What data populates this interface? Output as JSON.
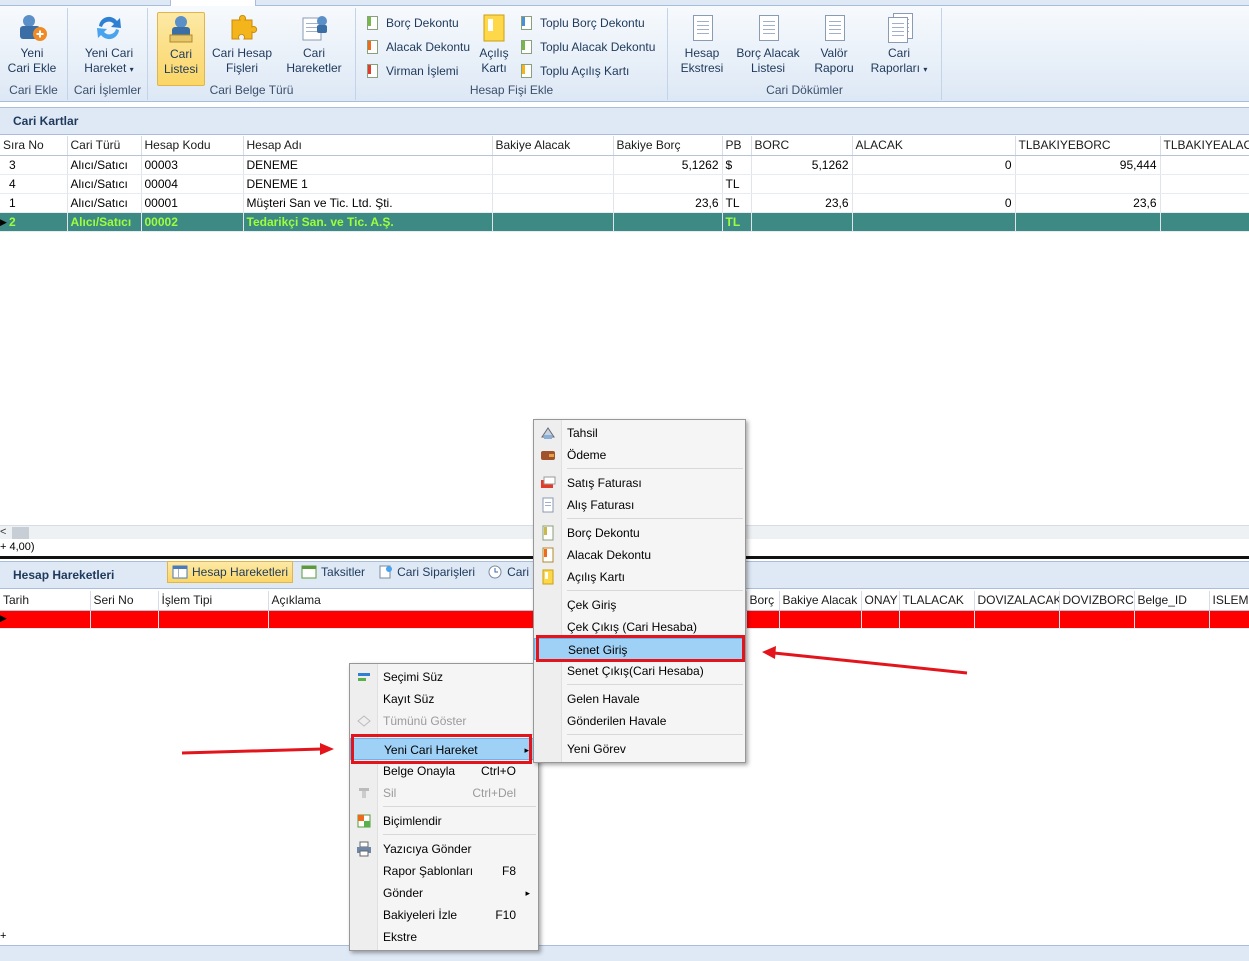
{
  "ribbon": {
    "groups": [
      {
        "caption": "Cari Ekle",
        "buttons": [
          {
            "label_l1": "Yeni",
            "label_l2": "Cari Ekle",
            "icon": "add-customer-icon"
          }
        ]
      },
      {
        "caption": "Cari İşlemler",
        "buttons": [
          {
            "label_l1": "Yeni Cari",
            "label_l2": "Hareket",
            "icon": "refresh-arrows-icon",
            "dropdown": "▾"
          }
        ]
      },
      {
        "caption": "Cari Belge Türü",
        "buttons": [
          {
            "label_l1": "Cari",
            "label_l2": "Listesi",
            "icon": "customer-list-icon"
          },
          {
            "label_l1": "Cari Hesap",
            "label_l2": "Fişleri",
            "icon": "puzzle-icon"
          },
          {
            "label_l1": "Cari",
            "label_l2": "Hareketler",
            "icon": "customer-movements-icon"
          }
        ]
      },
      {
        "caption": "Hesap Fişi Ekle",
        "small": [
          "Borç Dekontu",
          "Alacak Dekontu",
          "Virman İşlemi"
        ],
        "big": {
          "label_l1": "Açılış",
          "label_l2": "Kartı"
        },
        "small2": [
          "Toplu Borç Dekontu",
          "Toplu Alacak Dekontu",
          "Toplu Açılış Kartı"
        ]
      },
      {
        "caption": "Cari Dökümler",
        "buttons": [
          {
            "label_l1": "Hesap",
            "label_l2": "Ekstresi"
          },
          {
            "label_l1": "Borç Alacak",
            "label_l2": "Listesi"
          },
          {
            "label_l1": "Valör",
            "label_l2": "Raporu"
          },
          {
            "label_l1": "Cari",
            "label_l2": "Raporları",
            "dropdown": "▾"
          }
        ]
      }
    ]
  },
  "cari_kartlar": {
    "title": "Cari Kartlar",
    "columns": [
      "Sıra No",
      "Cari Türü",
      "Hesap Kodu",
      "Hesap Adı",
      "Bakiye Alacak",
      "Bakiye Borç",
      "PB",
      "BORC",
      "ALACAK",
      "TLBAKIYEBORC",
      "TLBAKIYEALACAK"
    ],
    "rows": [
      [
        "3",
        "Alıcı/Satıcı",
        "00003",
        "DENEME",
        "",
        "5,1262",
        "$",
        "5,1262",
        "0",
        "95,444",
        ""
      ],
      [
        "4",
        "Alıcı/Satıcı",
        "00004",
        "DENEME 1",
        "",
        "",
        "TL",
        "",
        "",
        "",
        ""
      ],
      [
        "1",
        "Alıcı/Satıcı",
        "00001",
        "Müşteri San ve Tic. Ltd. Şti.",
        "",
        "23,6",
        "TL",
        "23,6",
        "0",
        "23,6",
        ""
      ],
      [
        "2",
        "Alıcı/Satıcı",
        "00002",
        "Tedarikçi San. ve Tic. A.Ş.",
        "",
        "",
        "TL",
        "",
        "",
        "",
        ""
      ]
    ],
    "footer": "+ 4,00)",
    "scroll_left": "<"
  },
  "hesap_hareketleri": {
    "title": "Hesap Hareketleri",
    "tabs": [
      "Hesap Hareketleri",
      "Taksitler",
      "Cari Siparişleri",
      "Cari Görev"
    ],
    "columns": [
      "Tarih",
      "Seri No",
      "İşlem Tipi",
      "Açıklama",
      "Borç",
      "Bakiye Alacak",
      "ONAY",
      "TLALACAK",
      "DOVIZALACAK",
      "DOVIZBORC",
      "Belge_ID",
      "ISLEMKODU"
    ],
    "footer": "+"
  },
  "context_menu": {
    "items": [
      {
        "label": "Seçimi Süz",
        "icon": "filter-selection-icon"
      },
      {
        "label": "Kayıt Süz",
        "icon": ""
      },
      {
        "label": "Tümünü Göster",
        "icon": "show-all-icon",
        "disabled": true
      },
      {
        "sep": true
      },
      {
        "label": "Yeni Cari Hareket",
        "submenu": "▸",
        "highlighted": true
      },
      {
        "label": "Belge Onayla",
        "shortcut": "Ctrl+O"
      },
      {
        "label": "Sil",
        "shortcut": "Ctrl+Del",
        "icon": "delete-icon",
        "disabled": true
      },
      {
        "sep": true
      },
      {
        "label": "Biçimlendir",
        "icon": "format-icon"
      },
      {
        "sep": true
      },
      {
        "label": "Yazıcıya Gönder",
        "icon": "printer-icon"
      },
      {
        "label": "Rapor Şablonları",
        "shortcut": "F8"
      },
      {
        "label": "Gönder",
        "submenu": "▸"
      },
      {
        "label": "Bakiyeleri İzle",
        "shortcut": "F10"
      },
      {
        "label": "Ekstre"
      }
    ]
  },
  "submenu": {
    "items": [
      {
        "label": "Tahsil",
        "icon": "collect-icon"
      },
      {
        "label": "Ödeme",
        "icon": "payment-icon"
      },
      {
        "sep": true
      },
      {
        "label": "Satış Faturası",
        "icon": "sales-invoice-icon"
      },
      {
        "label": "Alış Faturası",
        "icon": "purchase-invoice-icon"
      },
      {
        "sep": true
      },
      {
        "label": "Borç Dekontu",
        "icon": "debit-note-icon"
      },
      {
        "label": "Alacak Dekontu",
        "icon": "credit-note-icon"
      },
      {
        "label": "Açılış Kartı",
        "icon": "opening-card-icon"
      },
      {
        "sep": true
      },
      {
        "label": "Çek Giriş"
      },
      {
        "label": "Çek Çıkış (Cari Hesaba)"
      },
      {
        "label": "Senet Giriş",
        "highlighted": true
      },
      {
        "label": "Senet Çıkış(Cari Hesaba)"
      },
      {
        "sep": true
      },
      {
        "label": "Gelen Havale"
      },
      {
        "label": "Gönderilen Havale"
      },
      {
        "sep": true
      },
      {
        "label": "Yeni Görev"
      }
    ]
  },
  "colors": {
    "focused_row_bg": "#3d8a85",
    "focused_row_text": "#9dff3c",
    "highlight": "#9fd0f5",
    "annotation_red": "#e3141b"
  }
}
